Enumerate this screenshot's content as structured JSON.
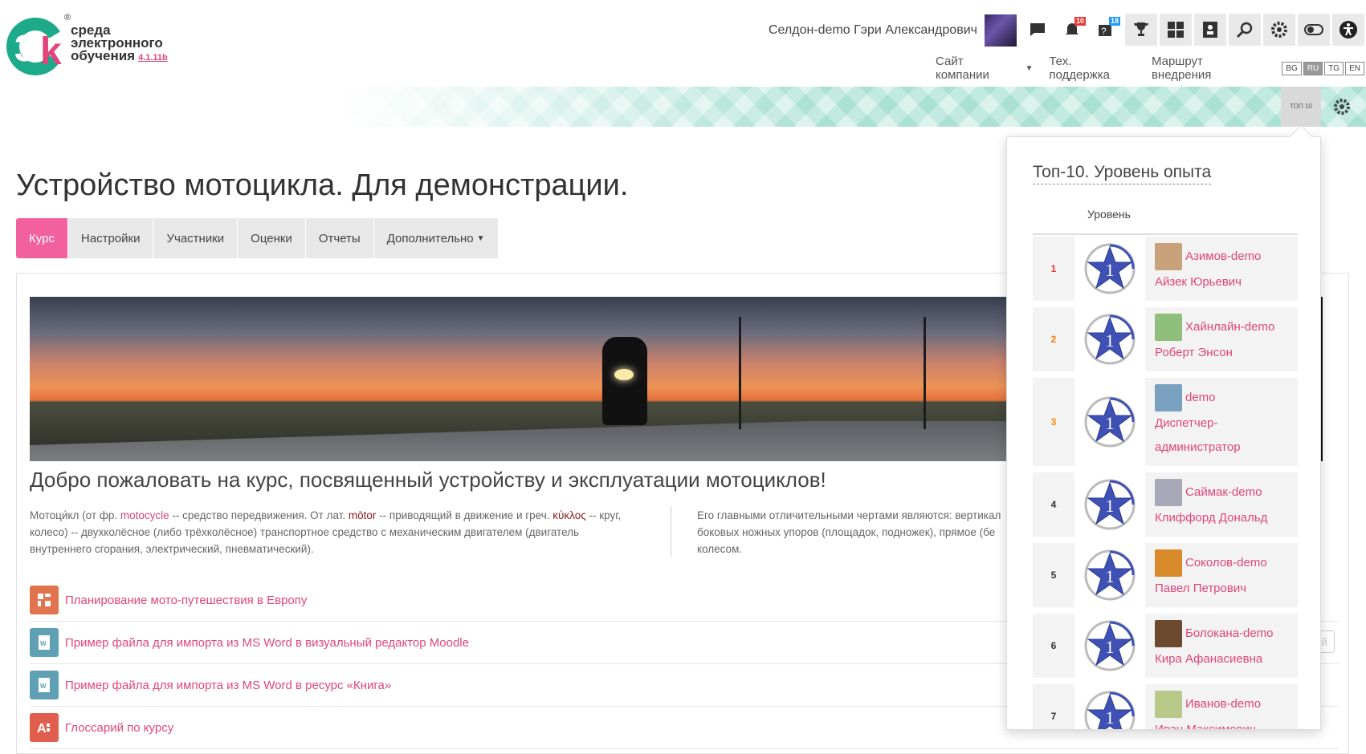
{
  "brand": {
    "line1": "среда",
    "line2": "электронного",
    "line3": "обучения",
    "version": "4.1.11b",
    "reg": "®",
    "colors": {
      "green": "#1daa8a",
      "pink": "#e0457b"
    }
  },
  "header": {
    "user_name": "Селдон-demo Гэри Александрович",
    "icons": [
      {
        "name": "chat-icon",
        "badge": ""
      },
      {
        "name": "notification-bell-icon",
        "badge": "10"
      },
      {
        "name": "help-queue-icon",
        "badge": "18"
      },
      {
        "name": "trophy-icon",
        "badge": ""
      },
      {
        "name": "dashboard-grid-icon",
        "badge": ""
      },
      {
        "name": "structure-icon",
        "badge": ""
      },
      {
        "name": "search-icon",
        "badge": ""
      },
      {
        "name": "gear-icon",
        "badge": ""
      },
      {
        "name": "toggle-icon",
        "badge": ""
      },
      {
        "name": "accessibility-icon",
        "badge": ""
      }
    ],
    "nav": {
      "company_site": "Сайт компании",
      "support": "Тех. поддержка",
      "route": "Маршрут внедрения"
    },
    "langs": [
      "BG",
      "RU",
      "TG",
      "EN"
    ],
    "active_lang": "RU"
  },
  "bar": {
    "top10_label": "ТОП 10"
  },
  "course": {
    "title": "Устройство мотоцикла. Для демонстрации.",
    "tabs": [
      "Курс",
      "Настройки",
      "Участники",
      "Оценки",
      "Отчеты",
      "Дополнительно"
    ],
    "welcome": "Добро пожаловать на курс, посвященный устройству и эксплуатации мотоциклов!",
    "desc_left": {
      "p1": "Мотоци́кл (от фр. ",
      "w1": "motocycle",
      "p2": " -- средство передвижения. От лат. ",
      "w2": "mōtor",
      "p3": " -- приводящий в движение и греч. ",
      "w3": "κύκλος",
      "p4": " -- круг, колесо) -- двухколёсное (либо трёхколёсное) транспортное средство с механическим двигателем (двигатель внутреннего сгорания, электрический, пневматический)."
    },
    "desc_right": {
      "l1": "Его главными отличительными чертами являются: вертикал",
      "l2": "боковых ножных упоров (площадок, подножек), прямое (бе",
      "l3": "колесом."
    },
    "activities": [
      {
        "label": "Планирование мото-путешествия в Европу",
        "icon": "mindmap-icon"
      },
      {
        "label": "Пример файла для импорта из MS Word в визуальный редактор Moodle",
        "icon": "word-doc-icon"
      },
      {
        "label": "Пример файла для импорта из MS Word в ресурс «Книга»",
        "icon": "word-doc-icon"
      },
      {
        "label": "Глоссарий по курсу",
        "icon": "glossary-icon"
      }
    ],
    "ghost_btn_text": "й"
  },
  "popover": {
    "title": "Топ-10. Уровень опыта",
    "col_level": "Уровень",
    "level_badge": "1",
    "rows": [
      {
        "rank": "1",
        "line1": "Азимов-demo",
        "line2": "Айзек Юрьевич",
        "line3": ""
      },
      {
        "rank": "2",
        "line1": "Хайнлайн-demo",
        "line2": "Роберт Энсон",
        "line3": ""
      },
      {
        "rank": "3",
        "line1": "demo",
        "line2": "Диспетчер-",
        "line3": "администратор"
      },
      {
        "rank": "4",
        "line1": "Саймак-demo",
        "line2": "Клиффорд Дональд",
        "line3": ""
      },
      {
        "rank": "5",
        "line1": "Соколов-demo",
        "line2": "Павел Петрович",
        "line3": ""
      },
      {
        "rank": "6",
        "line1": "Болокана-demo",
        "line2": "Кира Афанасиевна",
        "line3": ""
      },
      {
        "rank": "7",
        "line1": "Иванов-demo",
        "line2": "Иван Максимович",
        "line3": ""
      }
    ]
  }
}
